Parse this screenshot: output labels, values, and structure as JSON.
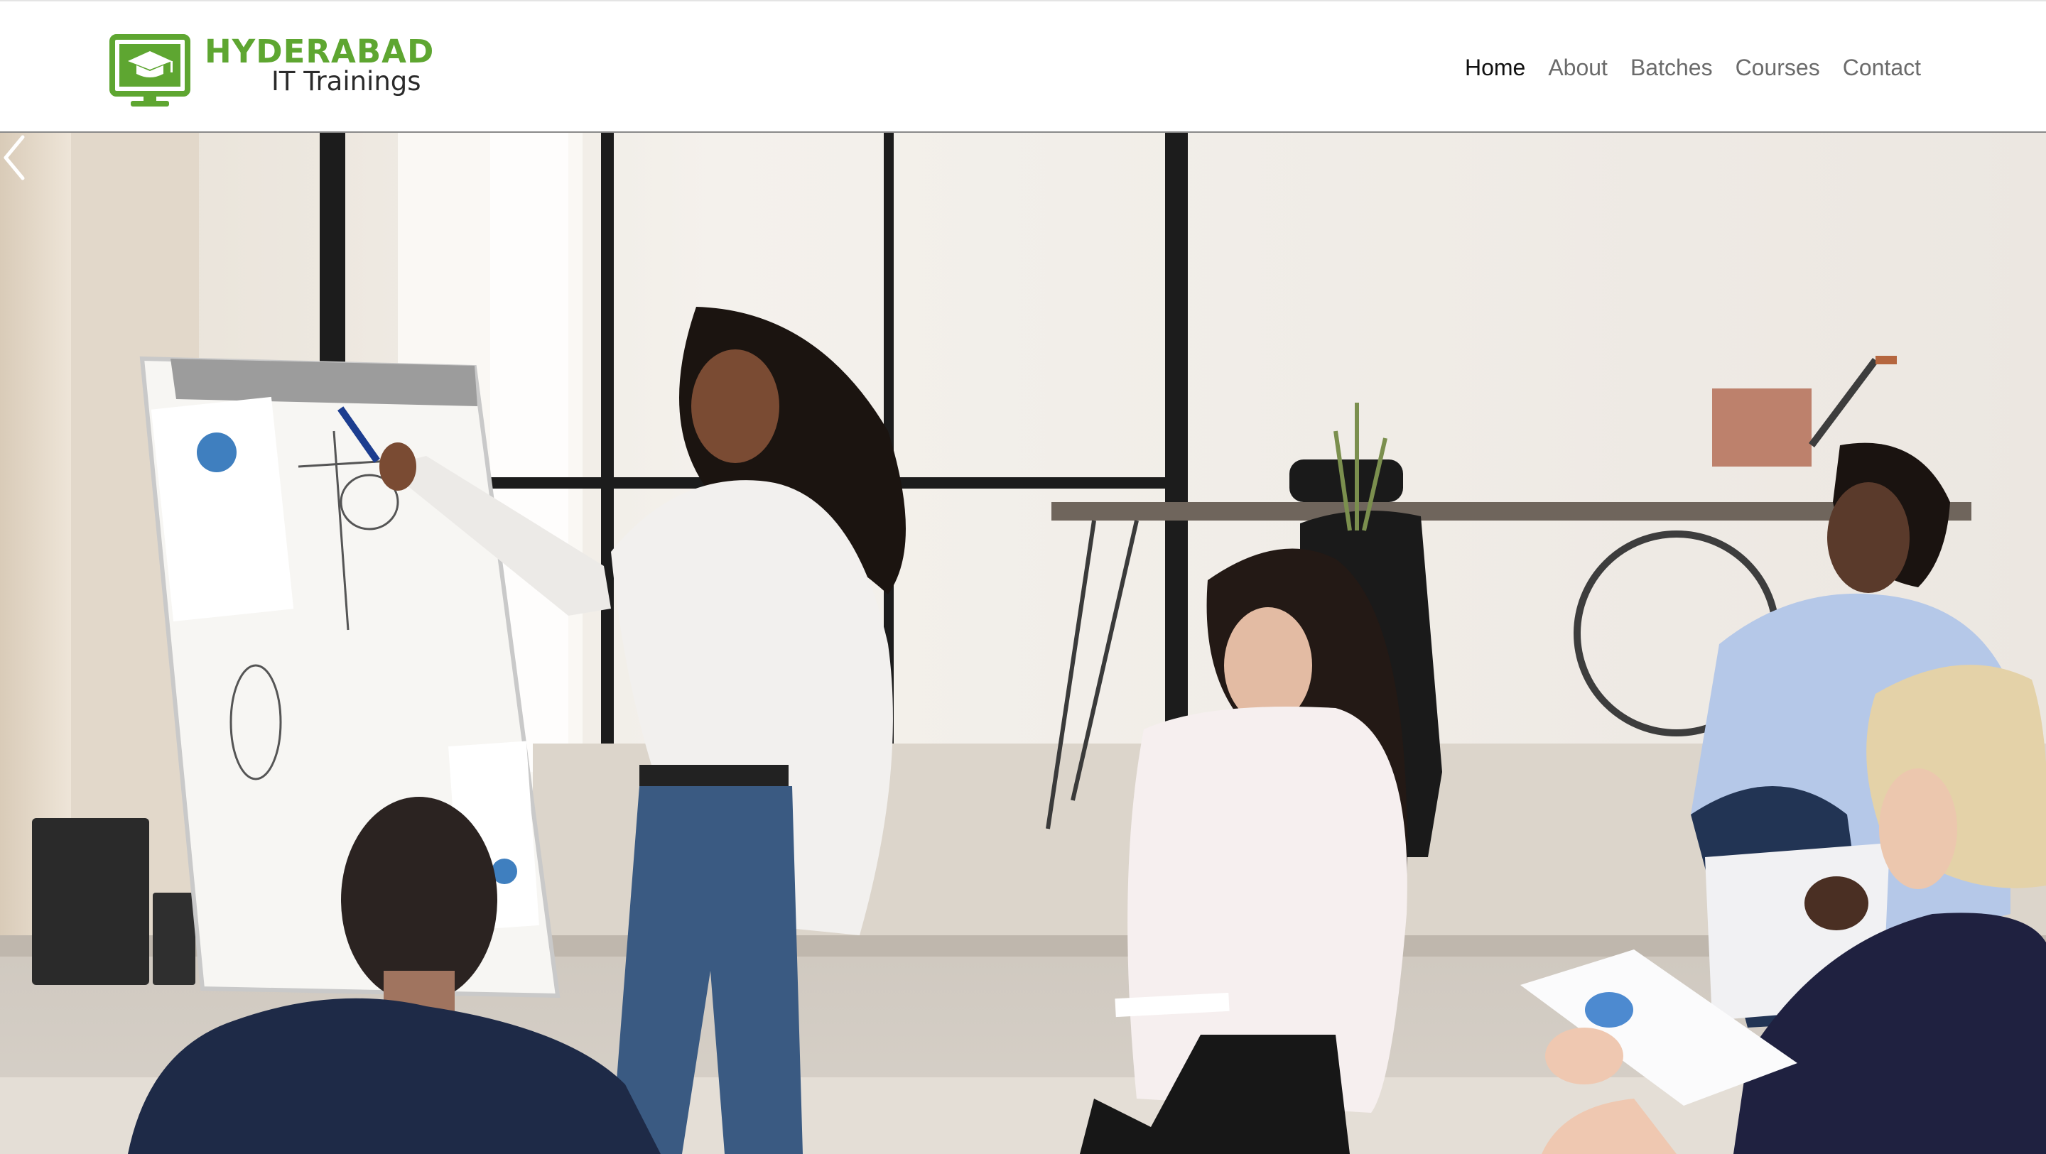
{
  "brand": {
    "title": "HYDERABAD",
    "subtitle": "IT Trainings",
    "color": "#5ea631",
    "icon": "graduation-cap-monitor-icon"
  },
  "nav": {
    "items": [
      {
        "label": "Home",
        "active": true
      },
      {
        "label": "About",
        "active": false
      },
      {
        "label": "Batches",
        "active": false
      },
      {
        "label": "Courses",
        "active": false
      },
      {
        "label": "Contact",
        "active": false
      }
    ]
  },
  "hero": {
    "image": "photo-presentation-in-office",
    "controls": {
      "prev": "chevron-left-icon"
    }
  }
}
